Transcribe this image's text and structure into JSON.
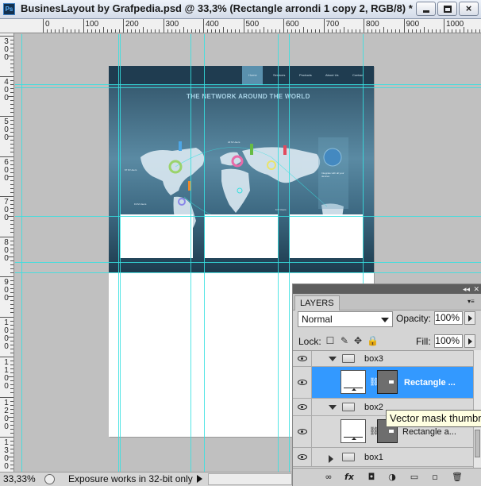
{
  "window": {
    "app_icon": "photoshop-icon",
    "title": "BusinesLayout by Grafpedia.psd @ 33,3% (Rectangle arrondi 1 copy 2, RGB/8) *",
    "buttons": [
      "minimize-icon",
      "maximize-icon",
      "close-icon"
    ],
    "close_glyph": "×"
  },
  "ruler_top": {
    "labels": [
      "0",
      "100",
      "200",
      "300",
      "400",
      "500",
      "600",
      "700",
      "800",
      "900",
      "1000"
    ]
  },
  "ruler_left": {
    "labels": [
      "300",
      "400",
      "500",
      "600",
      "700",
      "800",
      "900",
      "1000",
      "1100",
      "1200",
      "1300"
    ]
  },
  "document": {
    "nav_items": [
      "Home",
      "Services",
      "Products",
      "About Us",
      "Contact"
    ],
    "hero_title": "THE NETWORK AROUND THE WORLD",
    "map_labels": [
      "67 M Users",
      "22 M Users",
      "19 M Users",
      "6 M Users",
      "15 M Users"
    ],
    "side_text": "Integrate with all your devices",
    "accent_color": "#36e0e0"
  },
  "status": {
    "zoom": "33,33%",
    "message": "Exposure works in 32-bit only"
  },
  "layers_panel": {
    "tab": "LAYERS",
    "collapse_glyph": "◂◂",
    "close_glyph": "✕",
    "menu_glyph": "▾≡",
    "blend_mode": "Normal",
    "opacity_label": "Opacity:",
    "opacity_value": "100%",
    "lock_label": "Lock:",
    "lock_icons": [
      "☐",
      "✎",
      "✥",
      "🔒"
    ],
    "fill_label": "Fill:",
    "fill_value": "100%",
    "layers": [
      {
        "type": "group",
        "name": "box3",
        "expanded": true
      },
      {
        "type": "shape",
        "name": "Rectangle ...",
        "selected": true
      },
      {
        "type": "group",
        "name": "box2",
        "expanded": true
      },
      {
        "type": "shape",
        "name": "Rectangle a...",
        "selected": false
      },
      {
        "type": "group",
        "name": "box1",
        "expanded": false
      }
    ],
    "tooltip": "Vector mask thumbnail",
    "bottom_icons": [
      "∞",
      "fx",
      "◘",
      "◑",
      "▭",
      "▫",
      "🗑"
    ],
    "selected_color": "#3399ff"
  }
}
